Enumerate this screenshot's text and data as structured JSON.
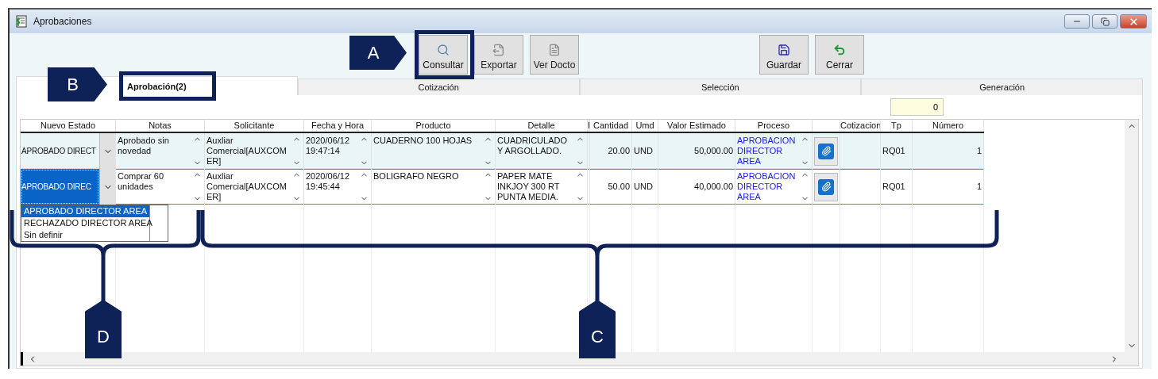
{
  "window": {
    "title": "Aprobaciones"
  },
  "toolbar": [
    {
      "label": "Consultar",
      "kind": "search",
      "disabled": false
    },
    {
      "label": "Exportar",
      "kind": "export",
      "disabled": true
    },
    {
      "label": "Ver Docto",
      "kind": "document",
      "disabled": true
    },
    {
      "label": "Guardar",
      "kind": "save",
      "disabled": false
    },
    {
      "label": "Cerrar",
      "kind": "undo",
      "disabled": false
    }
  ],
  "tabs": [
    {
      "label": "Aprobación(2)",
      "selected": true
    },
    {
      "label": "Cotización",
      "selected": false
    },
    {
      "label": "Selección",
      "selected": false
    },
    {
      "label": "Generación",
      "selected": false
    }
  ],
  "counter": "0",
  "table": {
    "columns": [
      {
        "label": "Nuevo Estado",
        "kind": "combo"
      },
      {
        "label": "Notas",
        "kind": "memo"
      },
      {
        "label": "Solicitante",
        "kind": "memo"
      },
      {
        "label": "Fecha y Hora",
        "kind": "memo"
      },
      {
        "label": "Producto",
        "kind": "memo"
      },
      {
        "label": "Detalle",
        "kind": "memo"
      },
      {
        "label": "I",
        "kind": "empty"
      },
      {
        "label": "Cantidad",
        "kind": "number"
      },
      {
        "label": "Umd",
        "kind": "text"
      },
      {
        "label": "Valor Estimado",
        "kind": "number"
      },
      {
        "label": "Proceso",
        "kind": "link"
      },
      {
        "kind": "attach"
      },
      {
        "label": "Cotizacion",
        "kind": "empty"
      },
      {
        "label": "Tp",
        "kind": "text"
      },
      {
        "label": "Número",
        "kind": "number"
      }
    ],
    "rows": [
      {
        "selected": false,
        "cells": [
          "APROBADO DIRECT",
          "Aprobado sin novedad",
          "Auxliar\nComercial[AUXCOM\nER]",
          "2020/06/12\n19:47:14",
          "CUADERNO 100 HOJAS",
          "CUADRICULADO\nY ARGOLLADO.",
          "",
          "20.00",
          "UND",
          "50,000.00",
          "APROBACION\nDIRECTOR\nAREA",
          "",
          "",
          "RQ01",
          "1"
        ]
      },
      {
        "selected": true,
        "cells": [
          "APROBADO DIREC",
          "Comprar 60\nunidades",
          "Auxliar\nComercial[AUXCOM\nER]",
          "2020/06/12\n19:45:44",
          "BOLIGRAFO NEGRO",
          "PAPER MATE\nINKJOY 300 RT\nPUNTA MEDIA.",
          "",
          "50.00",
          "UND",
          "40,000.00",
          "APROBACION\nDIRECTOR\nAREA",
          "",
          "",
          "RQ01",
          "1"
        ]
      }
    ]
  },
  "dropdown": [
    {
      "label": "APROBADO DIRECTOR AREA",
      "selected": true
    },
    {
      "label": "RECHAZADO DIRECTOR AREA",
      "selected": false
    },
    {
      "label": "Sin definir",
      "selected": false
    }
  ],
  "annotations": [
    {
      "label": "A",
      "kind": "pointer"
    },
    {
      "label": "B",
      "kind": "pointer"
    },
    {
      "label": "D",
      "kind": "brace"
    },
    {
      "label": "C",
      "kind": "brace"
    }
  ]
}
